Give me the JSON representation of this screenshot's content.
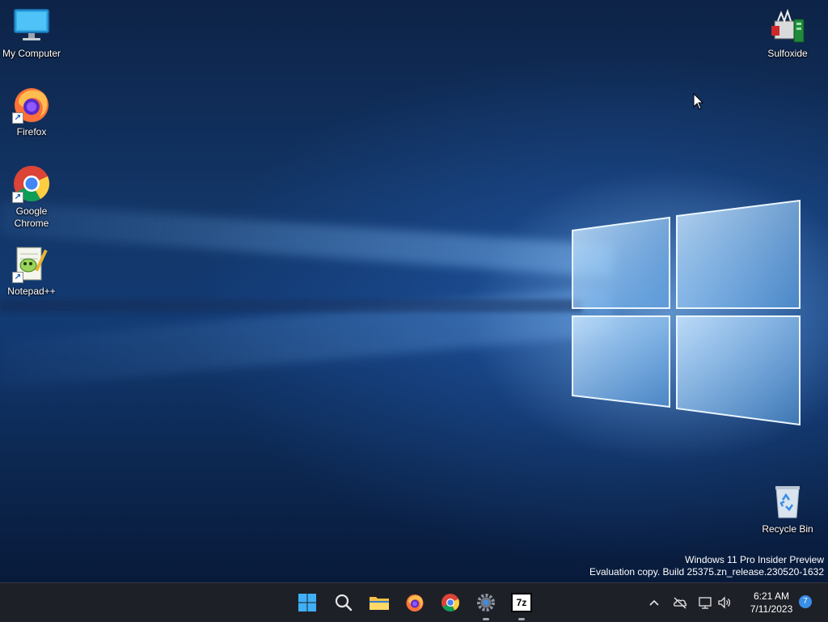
{
  "desktop": {
    "icons": {
      "my_computer": "My Computer",
      "firefox": "Firefox",
      "google_chrome": "Google\nChrome",
      "notepadpp": "Notepad++",
      "sulfoxide": "Sulfoxide",
      "recycle_bin": "Recycle Bin"
    },
    "watermark": {
      "line1": "Windows 11 Pro Insider Preview",
      "line2": "Evaluation copy. Build 25375.zn_release.230520-1632"
    }
  },
  "taskbar": {
    "apps": [
      {
        "icon": "windows-start-icon"
      },
      {
        "icon": "search-icon"
      },
      {
        "icon": "file-explorer-icon"
      },
      {
        "icon": "firefox-icon"
      },
      {
        "icon": "chrome-icon"
      },
      {
        "icon": "settings-gear-icon"
      },
      {
        "icon": "7zip-icon",
        "label": "7z"
      }
    ],
    "clock": {
      "time": "6:21 AM",
      "date": "7/11/2023"
    },
    "notification_count": "7"
  },
  "colors": {
    "taskbar_bg": "#1e2027",
    "accent": "#3a8ee6"
  }
}
